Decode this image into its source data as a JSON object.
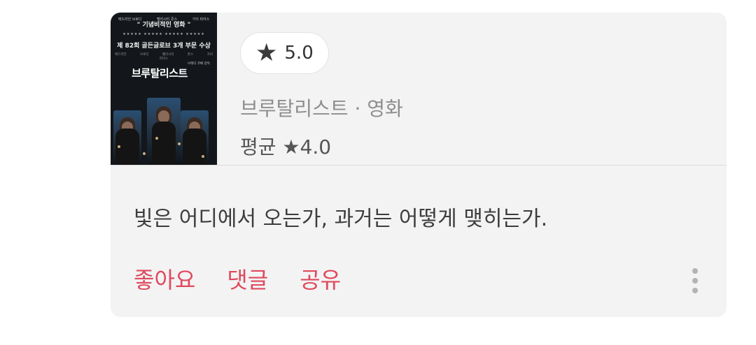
{
  "poster": {
    "cast": [
      "애드리언 브로디",
      "펠리시티 존스",
      "가이 피어스"
    ],
    "tagline": "\" 기념비적인 영화 \"",
    "stars": "★★★★★ ★★★★★ ★★★★★ ★★★★★",
    "award": "제 82회 골든글로브 3개 부문 수상",
    "cast2": "애드리언 브로디 펠리시티 존스 가이 피어스",
    "sub": "브래디 코베 감독",
    "title": "브루탈리스트"
  },
  "rating": {
    "icon": "star-icon",
    "star": "★",
    "value": "5.0"
  },
  "meta": {
    "title": "브루탈리스트 · 영화",
    "average": "평균 ★4.0"
  },
  "comment": "빛은 어디에서 오는가, 과거는 어떻게 맺히는가.",
  "actions": {
    "like": "좋아요",
    "comment": "댓글",
    "share": "공유"
  },
  "more_icon": "more-vertical-icon",
  "colors": {
    "accent": "#df4a5c",
    "card": "#f3f3f4"
  }
}
